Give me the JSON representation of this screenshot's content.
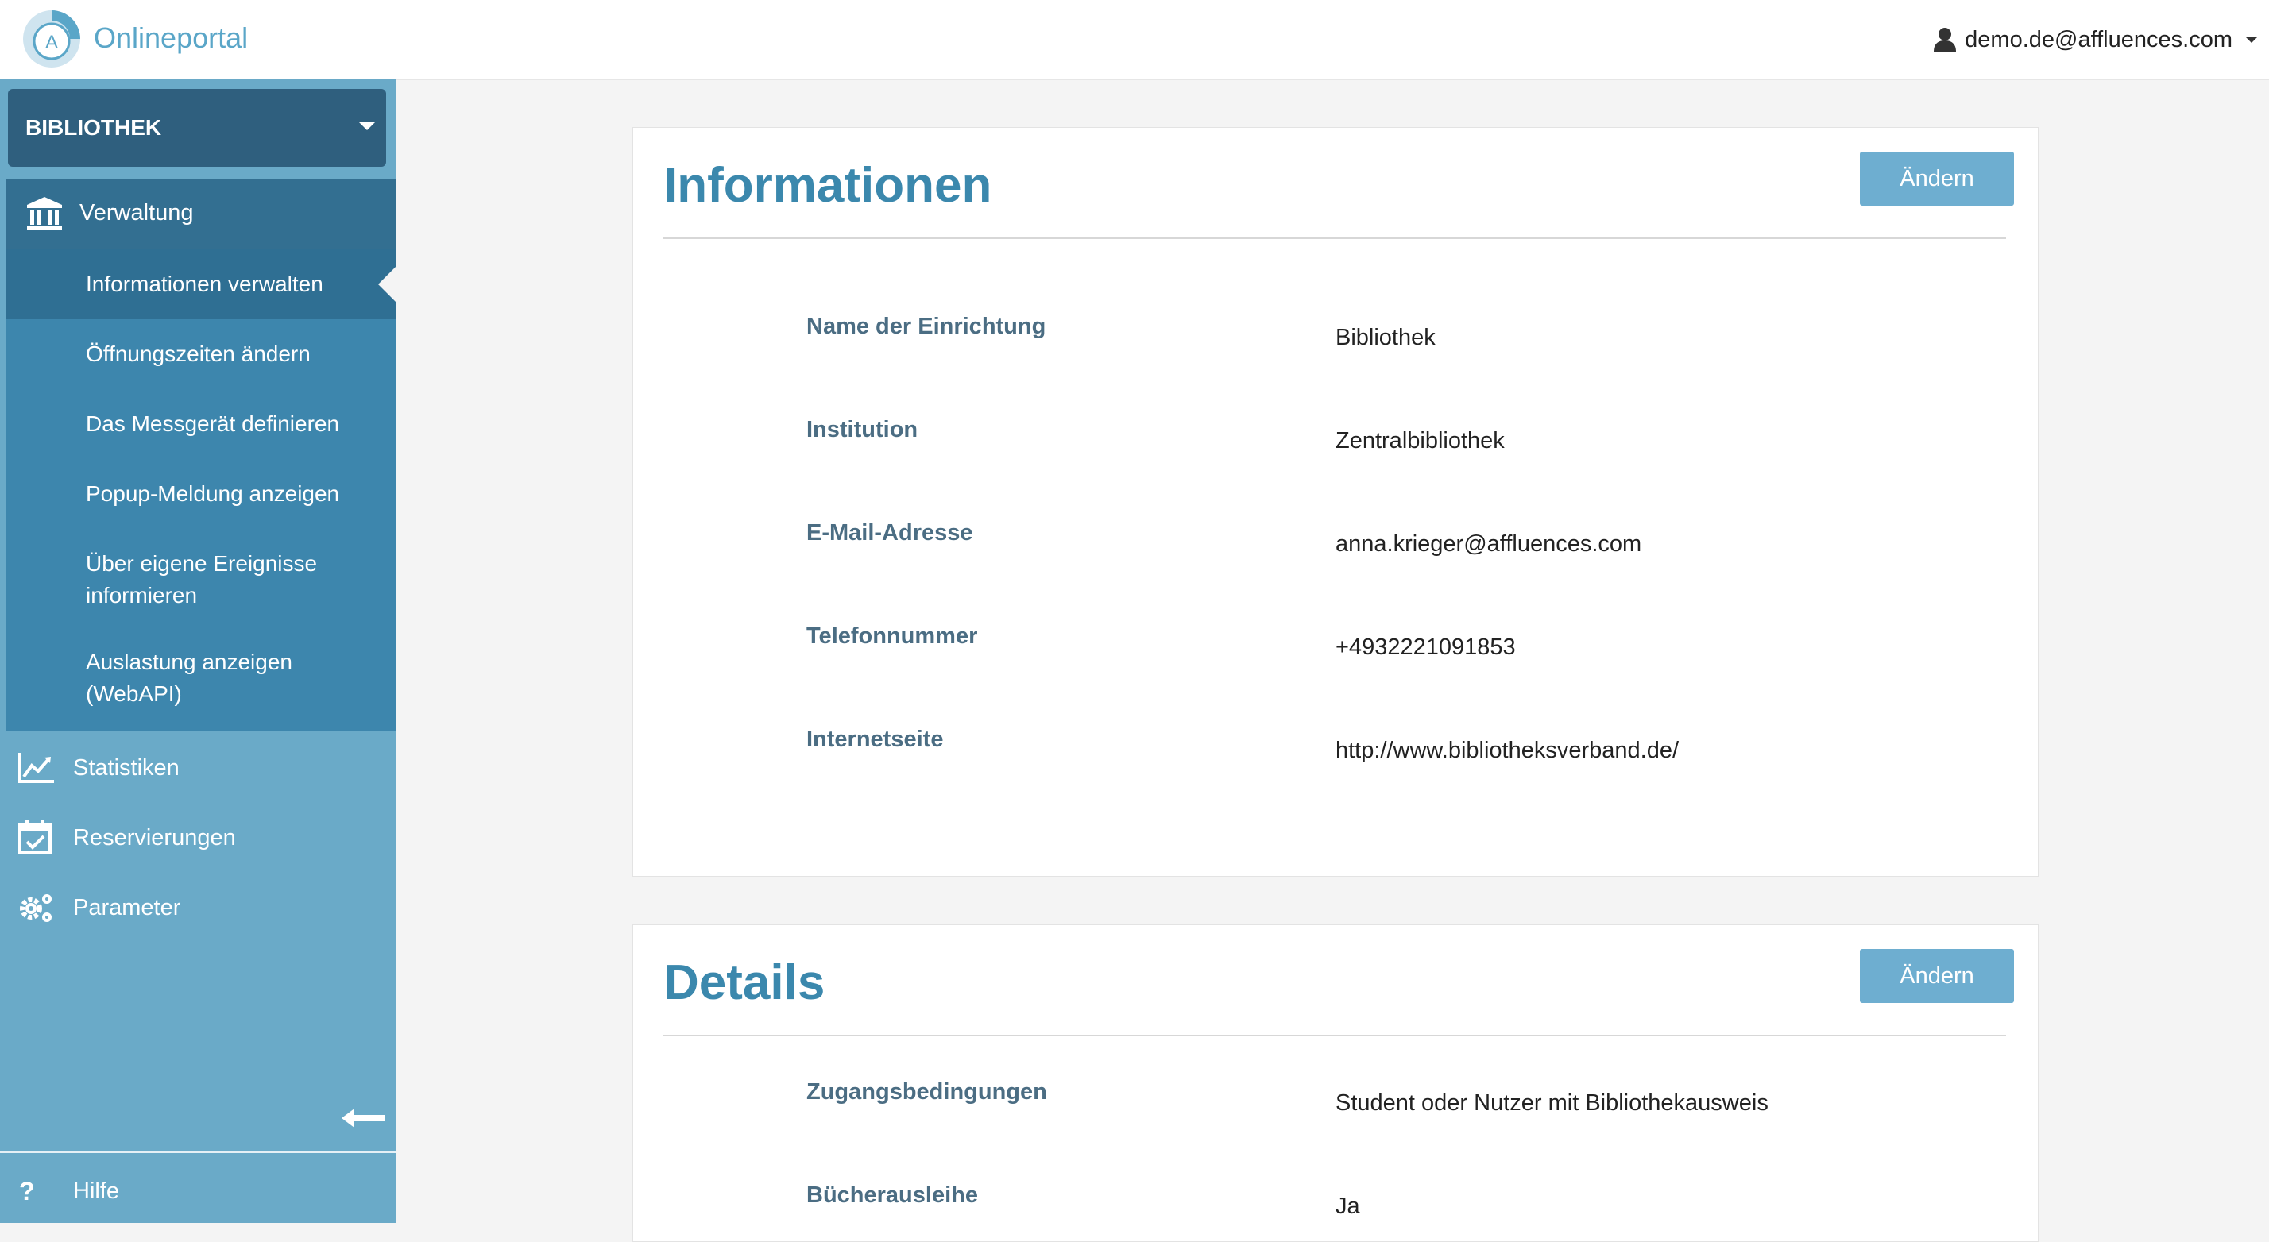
{
  "header": {
    "brand": "Onlineportal",
    "logo_letter": "A",
    "user_email": "demo.de@affluences.com"
  },
  "sidebar": {
    "library_select": "BIBLIOTHEK",
    "group": {
      "label": "Verwaltung",
      "items": [
        {
          "label": "Informationen verwalten",
          "active": true
        },
        {
          "label": "Öffnungszeiten ändern"
        },
        {
          "label": "Das Messgerät definieren"
        },
        {
          "label": "Popup-Meldung anzeigen"
        },
        {
          "label_line1": "Über eigene Ereignisse",
          "label_line2": "informieren"
        },
        {
          "label_line1": "Auslastung anzeigen",
          "label_line2": "(WebAPI)"
        }
      ]
    },
    "nav": [
      {
        "label": "Statistiken",
        "icon": "chart-icon"
      },
      {
        "label": "Reservierungen",
        "icon": "calendar-check-icon"
      },
      {
        "label": "Parameter",
        "icon": "gears-icon"
      }
    ],
    "help": {
      "symbol": "?",
      "label": "Hilfe"
    }
  },
  "informationen": {
    "title": "Informationen",
    "edit_label": "Ändern",
    "rows": [
      {
        "key": "Name der Einrichtung",
        "value": "Bibliothek"
      },
      {
        "key": "Institution",
        "value": "Zentralbibliothek"
      },
      {
        "key": "E-Mail-Adresse",
        "value": "anna.krieger@affluences.com"
      },
      {
        "key": "Telefonnummer",
        "value": "+4932221091853"
      },
      {
        "key": "Internetseite",
        "value": "http://www.bibliotheksverband.de/"
      }
    ]
  },
  "details": {
    "title": "Details",
    "edit_label": "Ändern",
    "rows": [
      {
        "key": "Zugangsbedingungen",
        "value": "Student oder Nutzer mit Bibliothekausweis"
      },
      {
        "key": "Bücherausleihe",
        "value": "Ja"
      }
    ]
  },
  "colors": {
    "accent": "#3b88ad",
    "sidebar": "#6aaac8",
    "sidebar_group": "#3d86ad",
    "button": "#6eaed0"
  }
}
